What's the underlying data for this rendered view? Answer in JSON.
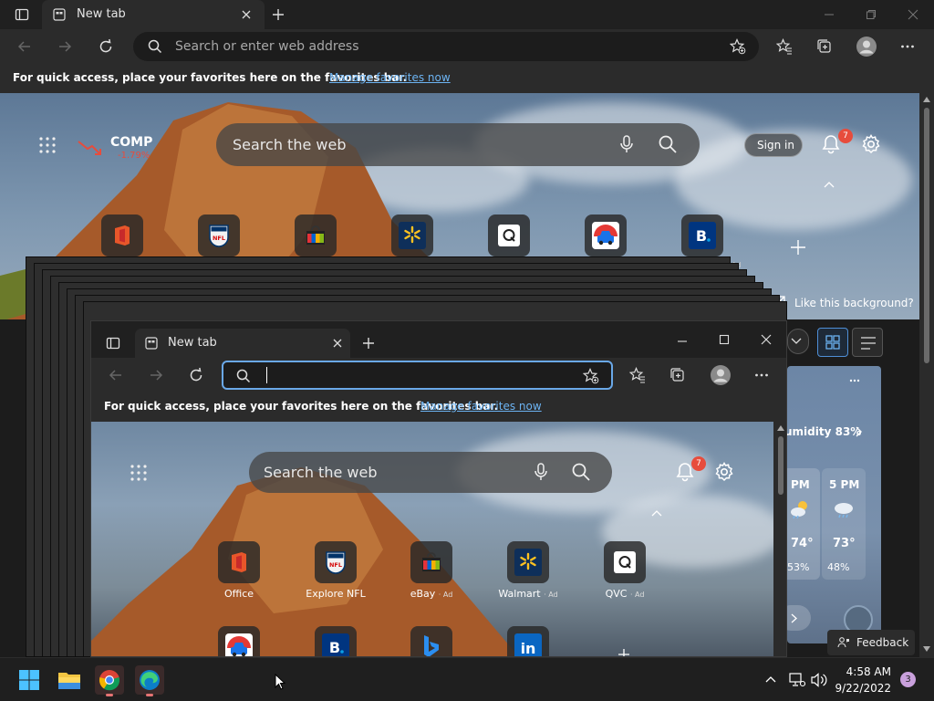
{
  "back_window": {
    "tab_title": "New tab",
    "address_placeholder": "Search or enter web address",
    "favbar_text": "For quick access, place your favorites here on the favorites bar.",
    "favbar_link": "Manage favorites now",
    "stock_symbol": "COMP",
    "stock_change": "-1.79%",
    "search_placeholder": "Search the web",
    "sign_in": "Sign in",
    "notification_count": "7",
    "like_background": "Like this background?",
    "ad_fragment": "Ad"
  },
  "front_window": {
    "tab_title": "New tab",
    "favbar_text": "For quick access, place your favorites here on the favorites bar.",
    "favbar_link": "Manage favorites now",
    "search_placeholder": "Search the web",
    "notification_count": "7",
    "tiles": [
      {
        "label": "Office",
        "ad": ""
      },
      {
        "label": "Explore NFL",
        "ad": ""
      },
      {
        "label": "eBay",
        "ad": "· Ad"
      },
      {
        "label": "Walmart",
        "ad": "· Ad"
      },
      {
        "label": "QVC",
        "ad": "· Ad"
      }
    ]
  },
  "weather": {
    "humidity": "umidity 83%",
    "col1_time": "PM",
    "col2_time": "5 PM",
    "col1_temp": "74°",
    "col2_temp": "73°",
    "col1_precip": "53%",
    "col2_precip": "48%"
  },
  "feedback": "Feedback",
  "taskbar": {
    "time": "4:58 AM",
    "date": "9/22/2022",
    "notification_badge": "3"
  },
  "colors": {
    "accent": "#6cb3f2",
    "badge": "#e74c3c",
    "chrome_red": "#e53935",
    "bing_blue": "#1a73e8"
  }
}
